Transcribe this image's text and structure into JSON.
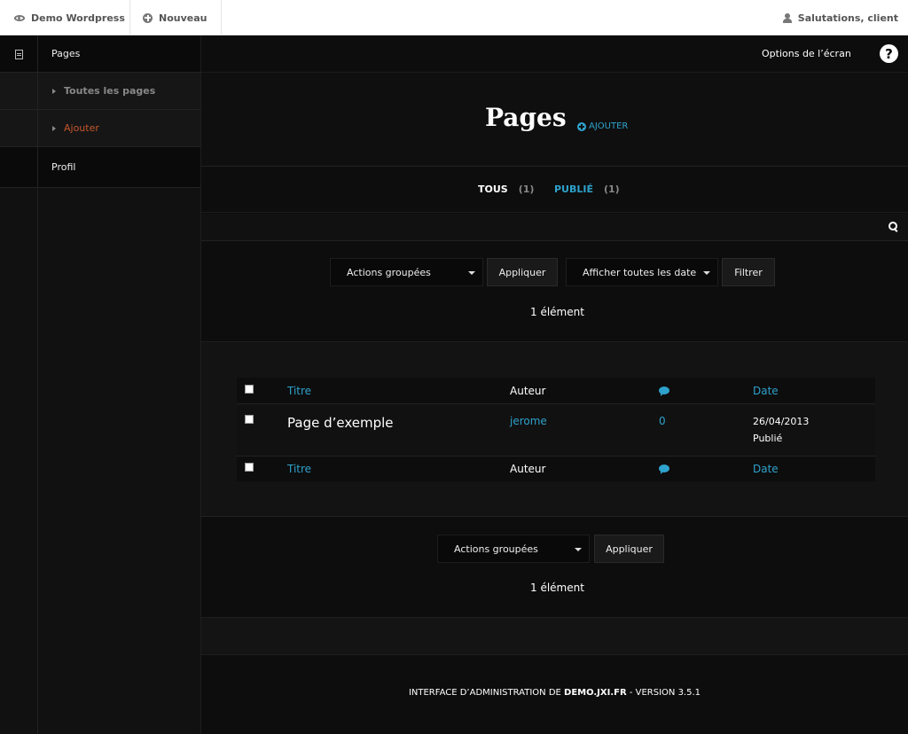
{
  "adminbar": {
    "site_name": "Demo Wordpress",
    "new_label": "Nouveau",
    "greeting": "Salutations, client"
  },
  "sidebar": {
    "items": [
      {
        "label": "Pages"
      },
      {
        "label": "Toutes les pages"
      },
      {
        "label": "Ajouter"
      },
      {
        "label": "Profil"
      }
    ]
  },
  "header": {
    "screen_options": "Options de l’écran",
    "help": "?"
  },
  "page": {
    "title": "Pages",
    "add_new": "AJOUTER"
  },
  "subsubsub": {
    "all_label": "TOUS",
    "all_count": "(1)",
    "published_label": "PUBLIÉ",
    "published_count": "(1)"
  },
  "tablenav_top": {
    "bulk_actions": "Actions groupées",
    "apply": "Appliquer",
    "dates_filter": "Afficher toutes les date",
    "filter": "Filtrer",
    "count": "1 élément"
  },
  "table": {
    "columns": {
      "title": "Titre",
      "author": "Auteur",
      "date": "Date"
    },
    "rows": [
      {
        "title": "Page d’exemple",
        "author": "jerome",
        "comments": "0",
        "date": "26/04/2013",
        "status": "Publié"
      }
    ]
  },
  "tablenav_bottom": {
    "bulk_actions": "Actions groupées",
    "apply": "Appliquer",
    "count": "1 élément"
  },
  "footer": {
    "prefix": "INTERFACE D’ADMINISTRATION DE ",
    "domain": "DEMO.JXI.FR",
    "suffix": " - VERSION 3.5.1"
  },
  "colors": {
    "accent": "#2ea2cc",
    "active_menu": "#c4562a",
    "background": "#0d0d0d"
  }
}
